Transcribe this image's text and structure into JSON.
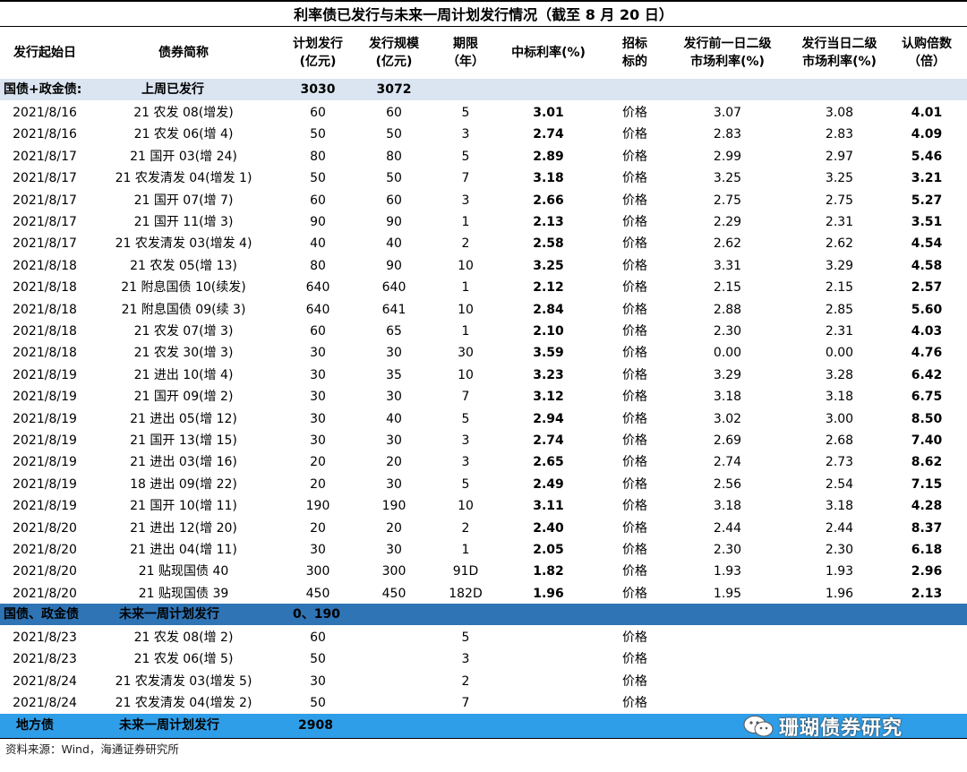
{
  "title": "利率债已发行与未来一周计划发行情况（截至 8 月 20 日）",
  "headers": [
    "发行起始日",
    "债券简称",
    "计划发行\n(亿元)",
    "发行规模\n(亿元)",
    "期限\n（年）",
    "中标利率(%)",
    "招标\n标的",
    "发行前一日二级\n市场利率(%)",
    "发行当日二级\n市场利率(%)",
    "认购倍数\n（倍）"
  ],
  "section1": {
    "label": "国债+政金债:",
    "sublabel": "上周已发行",
    "plan_total": "3030",
    "issued_total": "3072"
  },
  "rows1": [
    [
      "2021/8/16",
      "21 农发 08(增发)",
      "60",
      "60",
      "5",
      "3.01",
      "价格",
      "3.07",
      "3.08",
      "4.01"
    ],
    [
      "2021/8/16",
      "21 农发 06(增 4)",
      "50",
      "50",
      "3",
      "2.74",
      "价格",
      "2.83",
      "2.83",
      "4.09"
    ],
    [
      "2021/8/17",
      "21 国开 03(增 24)",
      "80",
      "80",
      "5",
      "2.89",
      "价格",
      "2.99",
      "2.97",
      "5.46"
    ],
    [
      "2021/8/17",
      "21 农发清发 04(增发 1)",
      "50",
      "50",
      "7",
      "3.18",
      "价格",
      "3.25",
      "3.25",
      "3.21"
    ],
    [
      "2021/8/17",
      "21 国开 07(增 7)",
      "60",
      "60",
      "3",
      "2.66",
      "价格",
      "2.75",
      "2.75",
      "5.27"
    ],
    [
      "2021/8/17",
      "21 国开 11(增 3)",
      "90",
      "90",
      "1",
      "2.13",
      "价格",
      "2.29",
      "2.31",
      "3.51"
    ],
    [
      "2021/8/17",
      "21 农发清发 03(增发 4)",
      "40",
      "40",
      "2",
      "2.58",
      "价格",
      "2.62",
      "2.62",
      "4.54"
    ],
    [
      "2021/8/18",
      "21 农发 05(增 13)",
      "80",
      "90",
      "10",
      "3.25",
      "价格",
      "3.31",
      "3.29",
      "4.58"
    ],
    [
      "2021/8/18",
      "21 附息国债 10(续发)",
      "640",
      "640",
      "1",
      "2.12",
      "价格",
      "2.15",
      "2.15",
      "2.57"
    ],
    [
      "2021/8/18",
      "21 附息国债 09(续 3)",
      "640",
      "641",
      "10",
      "2.84",
      "价格",
      "2.88",
      "2.85",
      "5.60"
    ],
    [
      "2021/8/18",
      "21 农发 07(增 3)",
      "60",
      "65",
      "1",
      "2.10",
      "价格",
      "2.30",
      "2.31",
      "4.03"
    ],
    [
      "2021/8/18",
      "21 农发 30(增 3)",
      "30",
      "30",
      "30",
      "3.59",
      "价格",
      "0.00",
      "0.00",
      "4.76"
    ],
    [
      "2021/8/19",
      "21 进出 10(增 4)",
      "30",
      "35",
      "10",
      "3.23",
      "价格",
      "3.29",
      "3.28",
      "6.42"
    ],
    [
      "2021/8/19",
      "21 国开 09(增 2)",
      "30",
      "30",
      "7",
      "3.12",
      "价格",
      "3.18",
      "3.18",
      "6.75"
    ],
    [
      "2021/8/19",
      "21 进出 05(增 12)",
      "30",
      "40",
      "5",
      "2.94",
      "价格",
      "3.02",
      "3.00",
      "8.50"
    ],
    [
      "2021/8/19",
      "21 国开 13(增 15)",
      "30",
      "30",
      "3",
      "2.74",
      "价格",
      "2.69",
      "2.68",
      "7.40"
    ],
    [
      "2021/8/19",
      "21 进出 03(增 16)",
      "20",
      "20",
      "3",
      "2.65",
      "价格",
      "2.74",
      "2.73",
      "8.62"
    ],
    [
      "2021/8/19",
      "18 进出 09(增 22)",
      "20",
      "30",
      "5",
      "2.49",
      "价格",
      "2.56",
      "2.54",
      "7.15"
    ],
    [
      "2021/8/19",
      "21 国开 10(增 11)",
      "190",
      "190",
      "10",
      "3.11",
      "价格",
      "3.18",
      "3.18",
      "4.28"
    ],
    [
      "2021/8/20",
      "21 进出 12(增 20)",
      "20",
      "20",
      "2",
      "2.40",
      "价格",
      "2.44",
      "2.44",
      "8.37"
    ],
    [
      "2021/8/20",
      "21 进出 04(增 11)",
      "30",
      "30",
      "1",
      "2.05",
      "价格",
      "2.30",
      "2.30",
      "6.18"
    ],
    [
      "2021/8/20",
      "21 贴现国债 40",
      "300",
      "300",
      "91D",
      "1.82",
      "价格",
      "1.93",
      "1.93",
      "2.96"
    ],
    [
      "2021/8/20",
      "21 贴现国债 39",
      "450",
      "450",
      "182D",
      "1.96",
      "价格",
      "1.95",
      "1.96",
      "2.13"
    ]
  ],
  "section2": {
    "label": "国债、政金债",
    "sublabel": "未来一周计划发行",
    "plan_total": "0、190"
  },
  "rows2": [
    [
      "2021/8/23",
      "21 农发 08(增 2)",
      "60",
      "",
      "5",
      "",
      "价格",
      "",
      "",
      ""
    ],
    [
      "2021/8/23",
      "21 农发 06(增 5)",
      "50",
      "",
      "3",
      "",
      "价格",
      "",
      "",
      ""
    ],
    [
      "2021/8/24",
      "21 农发清发 03(增发 5)",
      "30",
      "",
      "2",
      "",
      "价格",
      "",
      "",
      ""
    ],
    [
      "2021/8/24",
      "21 农发清发 04(增发 2)",
      "50",
      "",
      "7",
      "",
      "价格",
      "",
      "",
      ""
    ]
  ],
  "section3": {
    "label": "地方债",
    "sublabel": "未来一周计划发行",
    "plan_total": "2908"
  },
  "source": "资料来源：Wind，海通证券研究所",
  "brand": {
    "text": "珊瑚债券研究",
    "icon": "wechat-icon"
  },
  "colors": {
    "section1_bg": "#dbe5f1",
    "section2_bg": "#2f74b5",
    "section3_bg": "#2f9ee8"
  }
}
